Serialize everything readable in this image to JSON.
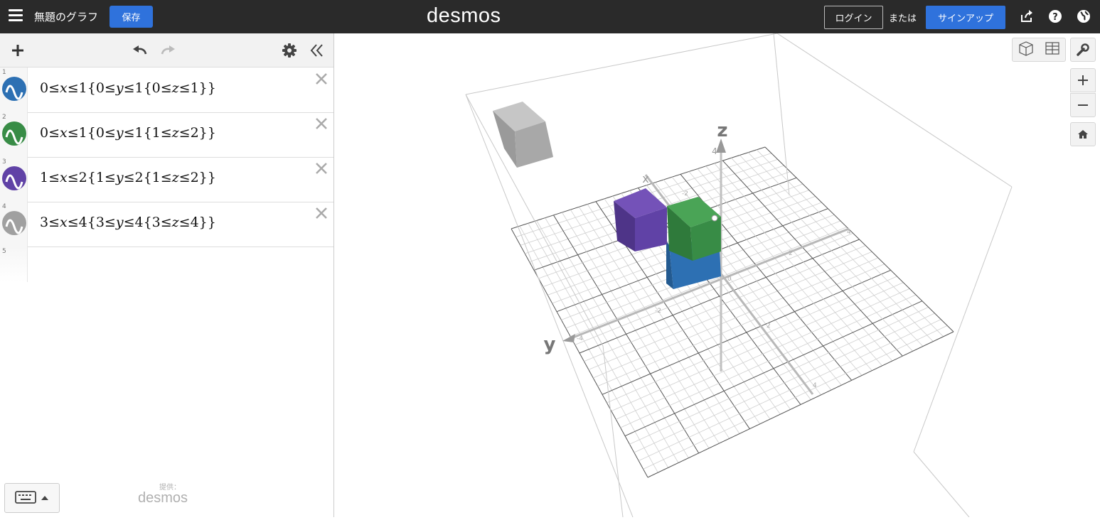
{
  "topbar": {
    "graph_title": "無題のグラフ",
    "save_label": "保存",
    "logo": "desmos",
    "login_label": "ログイン",
    "or_label": "または",
    "signup_label": "サインアップ",
    "icons": [
      "share-icon",
      "help-icon",
      "language-icon"
    ]
  },
  "expressions": [
    {
      "number": "1",
      "color": "#2d70b3",
      "latex": "0 ≤ x ≤ 1{0 ≤ y ≤ 1{0 ≤ z ≤ 1}}",
      "math": "0≤𝑥≤1{0≤𝑦≤1{0≤𝑧≤1}}"
    },
    {
      "number": "2",
      "color": "#388c46",
      "latex": "0 ≤ x ≤ 1{0 ≤ y ≤ 1{1 ≤ z ≤ 2}}",
      "math": "0≤𝑥≤1{0≤𝑦≤1{1≤𝑧≤2}}"
    },
    {
      "number": "3",
      "color": "#6042a6",
      "latex": "1 ≤ x ≤ 2{1 ≤ y ≤ 2{1 ≤ z ≤ 2}}",
      "math": "1≤𝑥≤2{1≤𝑦≤2{1≤𝑧≤2}}"
    },
    {
      "number": "4",
      "color": "#a0a0a0",
      "latex": "3 ≤ x ≤ 4{3 ≤ y ≤ 4{3 ≤ z ≤ 4}}",
      "math": "3≤𝑥≤4{3≤𝑦≤4{3≤𝑧≤4}}"
    }
  ],
  "empty_row_number": "5",
  "powered_by": {
    "label": "提供：",
    "logo": "desmos"
  },
  "graph": {
    "axis_labels": {
      "x": "x",
      "y": "y",
      "z": "z"
    },
    "z_tick": "4",
    "tick_labels": [
      "-2",
      "2",
      "-4",
      "4",
      "-2",
      "2",
      "4",
      "0"
    ]
  },
  "colors": {
    "topbar": "#2a2a2a",
    "accent": "#2f72dc"
  }
}
